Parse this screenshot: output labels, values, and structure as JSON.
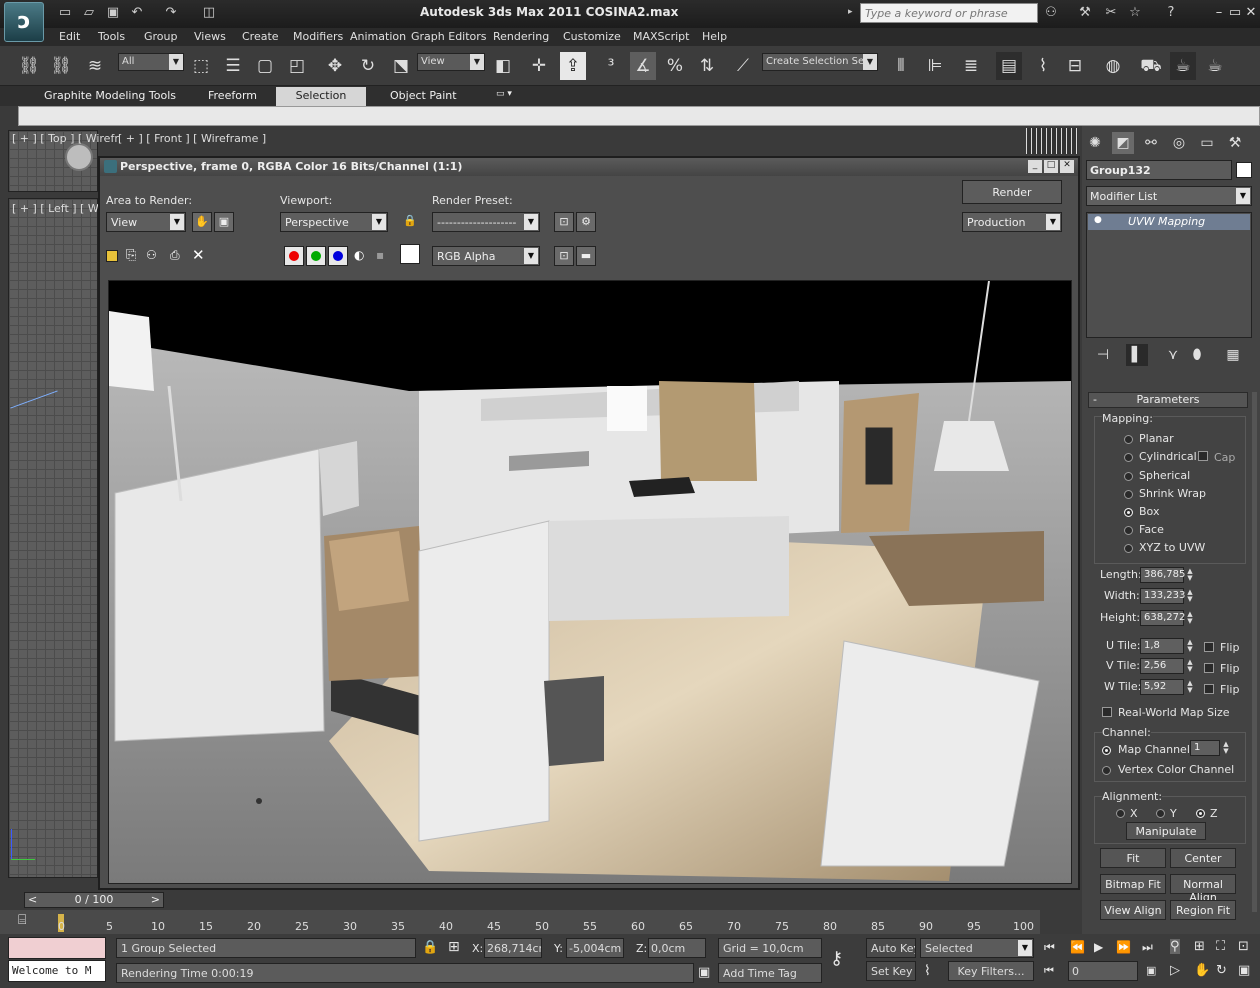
{
  "window": {
    "title": "Autodesk 3ds Max  2011      COSINA2.max",
    "search_placeholder": "Type a keyword or phrase"
  },
  "menu": [
    "Edit",
    "Tools",
    "Group",
    "Views",
    "Create",
    "Modifiers",
    "Animation",
    "Graph Editors",
    "Rendering",
    "Customize",
    "MAXScript",
    "Help"
  ],
  "main_toolbar": {
    "selection_filter": "All",
    "ref_coord": "View",
    "named_selection": "Create Selection Se"
  },
  "ribbon": {
    "tabs": [
      "Graphite Modeling Tools",
      "Freeform",
      "Selection",
      "Object Paint"
    ],
    "selected": "Selection"
  },
  "viewports": {
    "top_label": "[ + ] [ Top ] [ Wirefr",
    "front_label": "[ + ] [ Front ] [ Wireframe ]",
    "left_label": "[ + ] [ Left ] [ Wire"
  },
  "render_window": {
    "title": "Perspective, frame 0, RGBA Color 16 Bits/Channel (1:1)",
    "area_label": "Area to Render:",
    "area_value": "View",
    "viewport_label": "Viewport:",
    "viewport_value": "Perspective",
    "preset_label": "Render Preset:",
    "preset_value": "--------------------",
    "render_button": "Render",
    "render_mode": "Production",
    "channel_value": "RGB Alpha"
  },
  "command_panel": {
    "object_name": "Group132",
    "object_color": "#ffffff",
    "modifier_list": "Modifier List",
    "stack_item": "UVW Mapping",
    "rollout_title": "Parameters",
    "mapping_label": "Mapping:",
    "mapping_options": [
      "Planar",
      "Cylindrical",
      "Spherical",
      "Shrink Wrap",
      "Box",
      "Face",
      "XYZ to UVW"
    ],
    "mapping_selected": "Box",
    "cap_label": "Cap",
    "length_label": "Length:",
    "length": "386,785",
    "width_label": "Width:",
    "width": "133,233",
    "height_label": "Height:",
    "height": "638,272",
    "utile_label": "U Tile:",
    "utile": "1,8",
    "vtile_label": "V Tile:",
    "vtile": "2,56",
    "wtile_label": "W Tile:",
    "wtile": "5,92",
    "flip_label": "Flip",
    "realworld_label": "Real-World Map Size",
    "channel_label": "Channel:",
    "map_channel_label": "Map Channel:",
    "map_channel": "1",
    "vertex_color_label": "Vertex Color Channel",
    "alignment_label": "Alignment:",
    "axes": [
      "X",
      "Y",
      "Z"
    ],
    "axis_selected": "Z",
    "buttons": {
      "manipulate": "Manipulate",
      "fit": "Fit",
      "center": "Center",
      "bitmap_fit": "Bitmap Fit",
      "normal_align": "Normal Align",
      "view_align": "View Align",
      "region_fit": "Region Fit"
    }
  },
  "timeline": {
    "frame_counter": "0 / 100",
    "ticks": [
      "0",
      "5",
      "10",
      "15",
      "20",
      "25",
      "30",
      "35",
      "40",
      "45",
      "50",
      "55",
      "60",
      "65",
      "70",
      "75",
      "80",
      "85",
      "90",
      "95",
      "100"
    ]
  },
  "status": {
    "script_listener": "Welcome to M",
    "selection": "1 Group Selected",
    "render_time": "Rendering Time  0:00:19",
    "x_label": "X:",
    "x": "268,714cm",
    "y_label": "Y:",
    "y": "-5,004cm",
    "z_label": "Z:",
    "z": "0,0cm",
    "grid": "Grid = 10,0cm",
    "add_time_tag": "Add Time Tag",
    "auto_key": "Auto Key",
    "set_key": "Set Key",
    "key_mode": "Selected",
    "key_filters": "Key Filters...",
    "current_frame": "0"
  }
}
